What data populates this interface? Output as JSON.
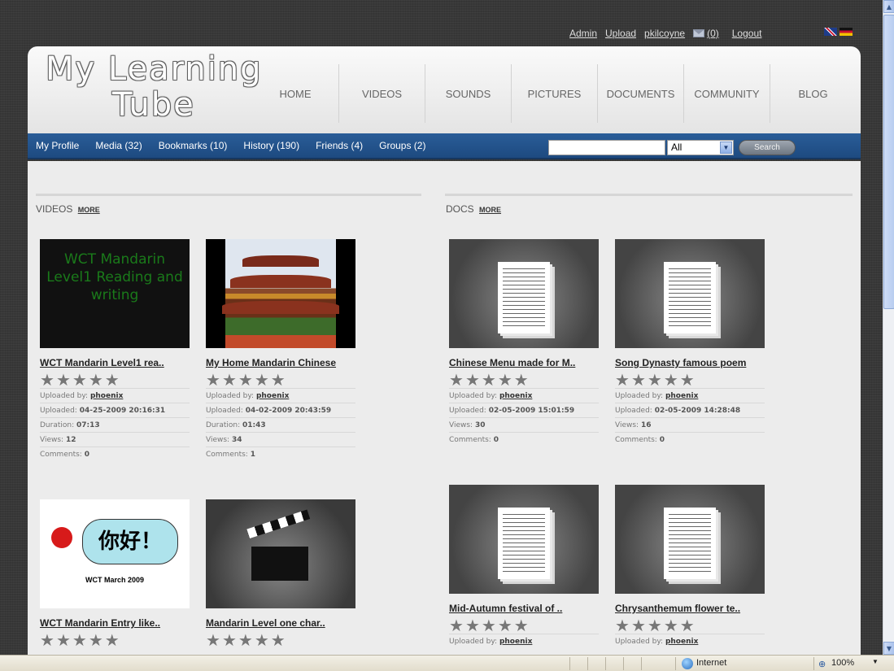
{
  "toplinks": {
    "admin": "Admin",
    "upload": "Upload",
    "user": "pkilcoyne",
    "messages": "(0)",
    "logout": "Logout"
  },
  "logo": {
    "line1": "My Learning",
    "line2": "Tube"
  },
  "mainnav": [
    "HOME",
    "VIDEOS",
    "SOUNDS",
    "PICTURES",
    "DOCUMENTS",
    "COMMUNITY",
    "BLOG"
  ],
  "subnav": [
    "My Profile",
    "Media (32)",
    "Bookmarks (10)",
    "History (190)",
    "Friends (4)",
    "Groups (2)"
  ],
  "search": {
    "value": "",
    "select_value": "All",
    "button": "Search"
  },
  "videos": {
    "title": "VIDEOS",
    "more": "MORE",
    "items": [
      {
        "thumb_text": "WCT Mandarin Level1 Reading and writing",
        "title": "WCT Mandarin Level1 rea..",
        "uploaded_by_label": "Uploaded by:",
        "uploaded_by": "phoenix",
        "uploaded_label": "Uploaded:",
        "uploaded": "04-25-2009 20:16:31",
        "duration_label": "Duration:",
        "duration": "07:13",
        "views_label": "Views:",
        "views": "12",
        "comments_label": "Comments:",
        "comments": "0"
      },
      {
        "title": "My Home Mandarin Chinese",
        "uploaded_by_label": "Uploaded by:",
        "uploaded_by": "phoenix",
        "uploaded_label": "Uploaded:",
        "uploaded": "04-02-2009 20:43:59",
        "duration_label": "Duration:",
        "duration": "01:43",
        "views_label": "Views:",
        "views": "34",
        "comments_label": "Comments:",
        "comments": "1"
      },
      {
        "thumb_text": "你好！",
        "thumb_caption": "WCT March 2009",
        "title": "WCT Mandarin Entry like.."
      },
      {
        "title": "Mandarin Level one char.."
      }
    ]
  },
  "docs": {
    "title": "DOCS",
    "more": "MORE",
    "items": [
      {
        "title": "Chinese Menu made for M..",
        "uploaded_by_label": "Uploaded by:",
        "uploaded_by": "phoenix",
        "uploaded_label": "Uploaded:",
        "uploaded": "02-05-2009 15:01:59",
        "views_label": "Views:",
        "views": "30",
        "comments_label": "Comments:",
        "comments": "0"
      },
      {
        "title": "Song Dynasty famous poem",
        "uploaded_by_label": "Uploaded by:",
        "uploaded_by": "phoenix",
        "uploaded_label": "Uploaded:",
        "uploaded": "02-05-2009 14:28:48",
        "views_label": "Views:",
        "views": "16",
        "comments_label": "Comments:",
        "comments": "0"
      },
      {
        "title": "Mid-Autumn festival of ..",
        "uploaded_by_label": "Uploaded by:",
        "uploaded_by": "phoenix"
      },
      {
        "title": "Chrysanthemum flower te..",
        "uploaded_by_label": "Uploaded by:",
        "uploaded_by": "phoenix"
      }
    ]
  },
  "statusbar": {
    "zone": "Internet",
    "zoom": "100%"
  },
  "icons": {
    "mail": "mail-icon",
    "star": "star-icon",
    "globe": "globe-icon",
    "zoom": "zoom-icon"
  }
}
